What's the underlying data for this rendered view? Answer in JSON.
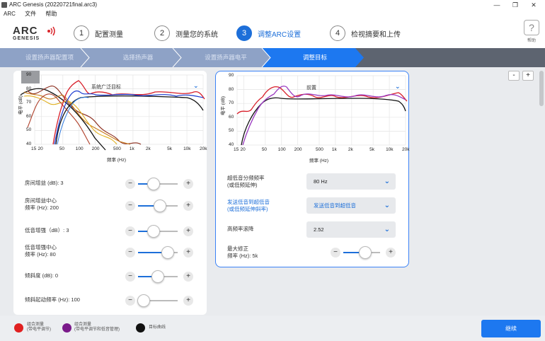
{
  "window": {
    "title": "ARC Genesis (20220721final.arc3)",
    "minimize": "—",
    "maximize": "❐",
    "close": "✕"
  },
  "menu": [
    "ARC",
    "文件",
    "帮助"
  ],
  "logo": {
    "line1": "ARC",
    "line2": "GENESIS"
  },
  "steps": [
    {
      "num": "1",
      "label": "配置测量"
    },
    {
      "num": "2",
      "label": "测量您的系统"
    },
    {
      "num": "3",
      "label": "调整ARC设置"
    },
    {
      "num": "4",
      "label": "检视摘要和上传"
    }
  ],
  "help": {
    "glyph": "?",
    "label": "帮助"
  },
  "breadcrumbs": [
    "设置扬声器配置项",
    "选择扬声器",
    "设置扬声器电平",
    "调整目标"
  ],
  "left_chart": {
    "title": "系统广泛目标",
    "ylabel": "电平 (dB)",
    "xlabel": "频率 (Hz)",
    "yticks": [
      "90",
      "80",
      "70",
      "60",
      "50",
      "40"
    ],
    "xticks": [
      "15",
      "20",
      "50",
      "100",
      "200",
      "500",
      "1k",
      "2k",
      "5k",
      "10k",
      "20k"
    ]
  },
  "right_chart": {
    "title": "前置",
    "ylabel": "电平 (dB)",
    "xlabel": "频率 (Hz)",
    "yticks": [
      "90",
      "80",
      "70",
      "60",
      "50",
      "40"
    ],
    "xticks": [
      "15",
      "20",
      "50",
      "100",
      "200",
      "500",
      "1k",
      "2k",
      "5k",
      "10k",
      "20k"
    ]
  },
  "left_controls": [
    {
      "label1": "房间增益 (dB): 3",
      "label2": "",
      "value": 0.4
    },
    {
      "label1": "房间增益中心",
      "label2": "频率 (Hz): 200",
      "value": 0.55
    },
    {
      "label1": "低音增强（dB）: 3",
      "label2": "",
      "value": 0.4
    },
    {
      "label1": "低音增强中心",
      "label2": "频率 (Hz): 80",
      "value": 0.75
    },
    {
      "label1": "倾斜度 (dB): 0",
      "label2": "",
      "value": 0.5
    },
    {
      "label1": "倾斜起动频率 (Hz): 100",
      "label2": "",
      "value": 0.15
    }
  ],
  "right_controls": {
    "crossover": {
      "label1": "超低音分频频率",
      "label2": "(或低频延伸)",
      "value": "80 Hz"
    },
    "send_low": {
      "label1": "发送低音到超低音",
      "label2": "(或低频延伸斜率)",
      "value": "发送低音到超低音"
    },
    "hf_rolloff": {
      "label1": "高频率滚降",
      "label2": "",
      "value": "2.52"
    },
    "max_correction": {
      "label1": "最大修正",
      "label2": "频率 (Hz): 5k",
      "value": 0.6
    }
  },
  "zoom": {
    "minus": "-",
    "plus": "+"
  },
  "stepper": {
    "minus": "−",
    "plus": "+"
  },
  "legend": [
    {
      "color": "#e02020",
      "line1": "组合测量",
      "line2": "(带电平调节)"
    },
    {
      "color": "#7a1a8a",
      "line1": "组合测量",
      "line2": "(带电平调节和低音管理)"
    },
    {
      "color": "#111111",
      "line1": "目标曲线",
      "line2": ""
    }
  ],
  "continue_label": "继续",
  "colors": {
    "accent": "#1d6fd9",
    "crumb_active": "#1d78f0",
    "crumb_bg": "#5d6470"
  }
}
